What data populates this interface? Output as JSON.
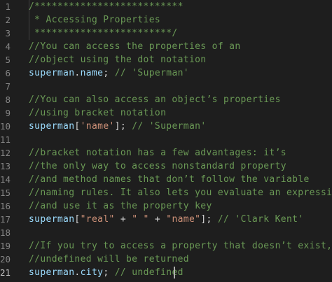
{
  "editor": {
    "line_numbers": [
      "1",
      "2",
      "3",
      "4",
      "5",
      "6",
      "7",
      "8",
      "9",
      "10",
      "11",
      "12",
      "13",
      "14",
      "15",
      "16",
      "17",
      "18",
      "19",
      "20",
      "21"
    ],
    "active_line": "21",
    "colors": {
      "background": "#1e1e1e",
      "comment": "#6a9955",
      "variable": "#9cdcfe",
      "text": "#d4d4d4",
      "string": "#ce9178",
      "line_number": "#858585"
    },
    "lines": [
      [
        {
          "t": "/**************************",
          "k": "comment"
        }
      ],
      [
        {
          "t": " * Accessing Properties",
          "k": "comment"
        }
      ],
      [
        {
          "t": " ************************/",
          "k": "comment"
        }
      ],
      [
        {
          "t": "//You can access the properties of an",
          "k": "comment"
        }
      ],
      [
        {
          "t": "//object using the dot notation",
          "k": "comment"
        }
      ],
      [
        {
          "t": "superman",
          "k": "var"
        },
        {
          "t": ".",
          "k": "plain"
        },
        {
          "t": "name",
          "k": "var"
        },
        {
          "t": "; ",
          "k": "plain"
        },
        {
          "t": "// 'Superman'",
          "k": "comment"
        }
      ],
      [],
      [
        {
          "t": "//You can also access an object’s properties",
          "k": "comment"
        }
      ],
      [
        {
          "t": "//using bracket notation",
          "k": "comment"
        }
      ],
      [
        {
          "t": "superman",
          "k": "var"
        },
        {
          "t": "[",
          "k": "plain"
        },
        {
          "t": "'name'",
          "k": "str"
        },
        {
          "t": "]; ",
          "k": "plain"
        },
        {
          "t": "// 'Superman'",
          "k": "comment"
        }
      ],
      [],
      [
        {
          "t": "//bracket notation has a few advantages: it’s",
          "k": "comment"
        }
      ],
      [
        {
          "t": "//the only way to access nonstandard property",
          "k": "comment"
        }
      ],
      [
        {
          "t": "//and method names that don’t follow the variable",
          "k": "comment"
        }
      ],
      [
        {
          "t": "//naming rules. It also lets you evaluate an expression",
          "k": "comment"
        }
      ],
      [
        {
          "t": "//and use it as the property key",
          "k": "comment"
        }
      ],
      [
        {
          "t": "superman",
          "k": "var"
        },
        {
          "t": "[",
          "k": "plain"
        },
        {
          "t": "\"real\"",
          "k": "str"
        },
        {
          "t": " + ",
          "k": "plain"
        },
        {
          "t": "\" \"",
          "k": "str"
        },
        {
          "t": " + ",
          "k": "plain"
        },
        {
          "t": "\"name\"",
          "k": "str"
        },
        {
          "t": "]; ",
          "k": "plain"
        },
        {
          "t": "// 'Clark Kent'",
          "k": "comment"
        }
      ],
      [],
      [
        {
          "t": "//If you try to access a property that doesn’t exist,",
          "k": "comment"
        }
      ],
      [
        {
          "t": "//undefined will be returned",
          "k": "comment"
        }
      ],
      [
        {
          "t": "superman",
          "k": "var"
        },
        {
          "t": ".",
          "k": "plain"
        },
        {
          "t": "city",
          "k": "var"
        },
        {
          "t": "; ",
          "k": "plain"
        },
        {
          "t": "// undefined",
          "k": "comment"
        }
      ]
    ]
  }
}
